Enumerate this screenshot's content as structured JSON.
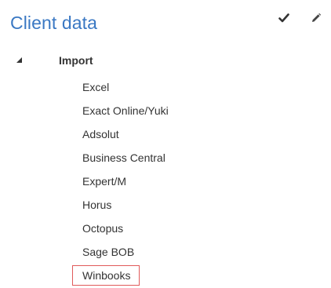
{
  "panel": {
    "title": "Client data",
    "toolbar": {
      "confirm_icon": "checkmark-icon",
      "edit_icon": "pencil-icon"
    }
  },
  "tree": {
    "root": {
      "label": "Import",
      "expanded": true,
      "toggle_icon": "expanded-triangle-icon"
    },
    "children": [
      {
        "label": "Excel",
        "selected": false
      },
      {
        "label": "Exact Online/Yuki",
        "selected": false
      },
      {
        "label": "Adsolut",
        "selected": false
      },
      {
        "label": "Business Central",
        "selected": false
      },
      {
        "label": "Expert/M",
        "selected": false
      },
      {
        "label": "Horus",
        "selected": false
      },
      {
        "label": "Octopus",
        "selected": false
      },
      {
        "label": "Sage BOB",
        "selected": false
      },
      {
        "label": "Winbooks",
        "selected": true
      }
    ]
  },
  "colors": {
    "title": "#3a78c3",
    "text": "#333333",
    "selection_border": "#e05a5a"
  }
}
